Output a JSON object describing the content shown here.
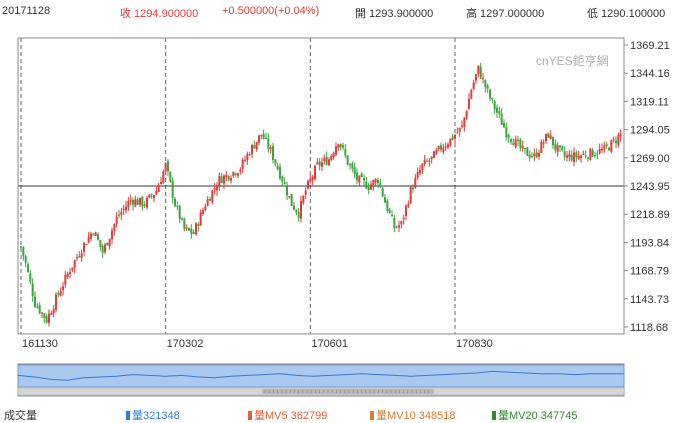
{
  "header": {
    "date": "20171128",
    "close_label": "收 1294.900000",
    "change_label": "+0.500000(+0.04%)",
    "open_label": "開 1293.900000",
    "high_label": "高 1297.000000",
    "low_label": "低 1290.100000"
  },
  "watermark": "cnYES鉅亨網",
  "chart_data": {
    "type": "candlestick",
    "y_ticks": [
      "1369.21",
      "1344.16",
      "1319.11",
      "1294.05",
      "1269.00",
      "1243.95",
      "1218.89",
      "1193.84",
      "1168.79",
      "1143.73",
      "1118.68"
    ],
    "ylim": [
      1118.68,
      1369.21
    ],
    "x_ticks": [
      "161130",
      "170302",
      "170601",
      "170830"
    ],
    "x_tick_index": [
      0,
      62,
      124,
      186
    ],
    "reference_line": 1243.95,
    "anchors": [
      [
        0,
        1190
      ],
      [
        2,
        1175
      ],
      [
        6,
        1140
      ],
      [
        11,
        1125
      ],
      [
        16,
        1148
      ],
      [
        21,
        1170
      ],
      [
        27,
        1192
      ],
      [
        31,
        1205
      ],
      [
        35,
        1185
      ],
      [
        41,
        1215
      ],
      [
        47,
        1232
      ],
      [
        53,
        1228
      ],
      [
        58,
        1240
      ],
      [
        62,
        1262
      ],
      [
        66,
        1228
      ],
      [
        70,
        1205
      ],
      [
        74,
        1202
      ],
      [
        79,
        1228
      ],
      [
        85,
        1250
      ],
      [
        90,
        1255
      ],
      [
        94,
        1260
      ],
      [
        98,
        1275
      ],
      [
        103,
        1290
      ],
      [
        107,
        1275
      ],
      [
        112,
        1250
      ],
      [
        116,
        1228
      ],
      [
        119,
        1220
      ],
      [
        122,
        1240
      ],
      [
        127,
        1262
      ],
      [
        132,
        1268
      ],
      [
        136,
        1285
      ],
      [
        140,
        1265
      ],
      [
        144,
        1250
      ],
      [
        149,
        1244
      ],
      [
        153,
        1250
      ],
      [
        156,
        1230
      ],
      [
        160,
        1207
      ],
      [
        163,
        1210
      ],
      [
        167,
        1240
      ],
      [
        172,
        1262
      ],
      [
        176,
        1268
      ],
      [
        180,
        1278
      ],
      [
        184,
        1285
      ],
      [
        189,
        1296
      ],
      [
        193,
        1330
      ],
      [
        196,
        1348
      ],
      [
        201,
        1322
      ],
      [
        205,
        1305
      ],
      [
        208,
        1292
      ],
      [
        212,
        1282
      ],
      [
        215,
        1275
      ],
      [
        220,
        1270
      ],
      [
        223,
        1280
      ],
      [
        226,
        1290
      ],
      [
        229,
        1278
      ],
      [
        233,
        1270
      ],
      [
        237,
        1270
      ],
      [
        242,
        1272
      ],
      [
        246,
        1274
      ],
      [
        250,
        1276
      ],
      [
        254,
        1283
      ],
      [
        257,
        1290
      ]
    ],
    "navigator_values": [
      0.6,
      0.5,
      0.35,
      0.3,
      0.45,
      0.5,
      0.55,
      0.65,
      0.6,
      0.55,
      0.6,
      0.5,
      0.45,
      0.55,
      0.6,
      0.65,
      0.7,
      0.6,
      0.55,
      0.6,
      0.65,
      0.7,
      0.65,
      0.6,
      0.55,
      0.6,
      0.65,
      0.7,
      0.75,
      0.85,
      0.8,
      0.75,
      0.7,
      0.7,
      0.65,
      0.7,
      0.7,
      0.7
    ]
  },
  "volume": {
    "title": "成交量",
    "vol_label": "量321348",
    "mv5_label": "量MV5 362799",
    "mv10_label": "量MV10 348518",
    "mv20_label": "量MV20 347745"
  },
  "colors": {
    "up": "#e33a3a",
    "down": "#3aa53a",
    "vol": "#2d7fd6",
    "mv5": "#e06030",
    "mv10": "#e07a30",
    "mv20": "#2e8b2e"
  }
}
